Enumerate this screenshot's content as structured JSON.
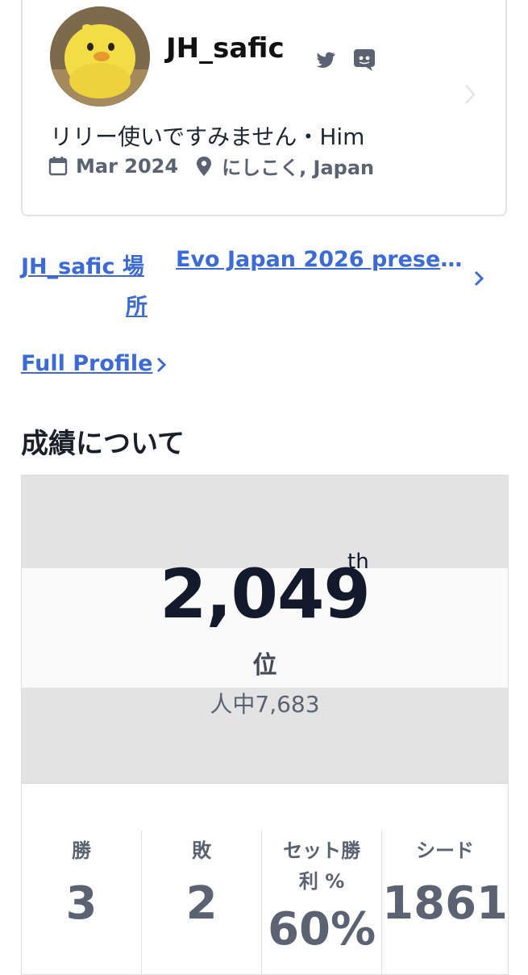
{
  "profile": {
    "username": "JH_safic",
    "bio": "リリー使いですみません・Him",
    "joined": "Mar 2024",
    "location": "にしこく, Japan",
    "icons": [
      "twitter-icon",
      "discord-icon",
      "calendar-icon",
      "location-pin-icon",
      "chevron-right-icon"
    ]
  },
  "links": {
    "user_location_line1": "JH_safic 場",
    "user_location_line2": "所",
    "event": "Evo Japan 2026 presen…",
    "full_profile": "Full Profile"
  },
  "section_title": "成績について",
  "results": {
    "rank": "2,049",
    "rank_suffix": "th",
    "rank_unit": "位",
    "total": "人中7,683"
  },
  "stats": [
    {
      "label": "勝",
      "value": "3"
    },
    {
      "label": "敗",
      "value": "2"
    },
    {
      "label": "セット勝利 %",
      "value": "60%"
    },
    {
      "label": "シード",
      "value": "1861"
    }
  ],
  "colors": {
    "link": "#3c6bd8",
    "gray_band": "#e3e3e3",
    "text_muted": "#5b6372"
  }
}
